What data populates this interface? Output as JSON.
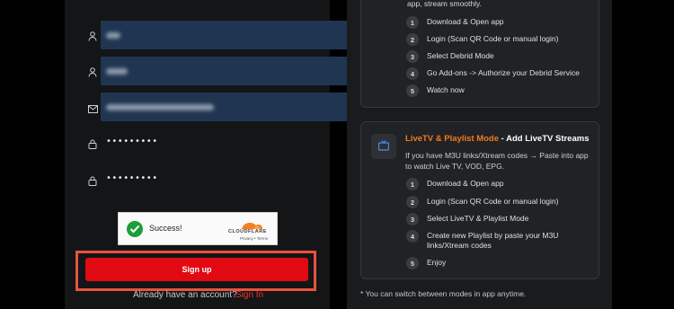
{
  "form": {
    "fields": [
      {
        "type": "text",
        "icon": "user-icon",
        "masked": false
      },
      {
        "type": "text",
        "icon": "user-icon",
        "masked": false
      },
      {
        "type": "email",
        "icon": "mail-icon",
        "masked": false
      },
      {
        "type": "password",
        "icon": "lock-icon",
        "value": "•••••••••"
      },
      {
        "type": "password",
        "icon": "lock-icon",
        "value": "•••••••••"
      }
    ],
    "captcha": {
      "status": "Success!",
      "provider": "CLOUDFLARE",
      "links": "Privacy • Terms"
    },
    "signup_label": "Sign up",
    "already_text": "Already have an account?",
    "signin_label": "Sign In"
  },
  "right": {
    "card1": {
      "cut_text": "app, stream smoothly.",
      "steps": [
        {
          "num": "1",
          "text": "Download & Open app"
        },
        {
          "num": "2",
          "text": "Login (Scan QR Code or manual login)"
        },
        {
          "num": "3",
          "text": "Select Debrid Mode"
        },
        {
          "num": "4",
          "text": "Go Add-ons -> Authorize your Debrid Service"
        },
        {
          "num": "5",
          "text": "Watch now"
        }
      ]
    },
    "card2": {
      "title_highlight": "LiveTV & Playlist Mode",
      "title_rest": " - Add LiveTV Streams",
      "description": "If you have M3U links/Xtream codes → Paste into app to watch Live TV, VOD, EPG.",
      "steps": [
        {
          "num": "1",
          "text": "Download & Open app"
        },
        {
          "num": "2",
          "text": "Login (Scan QR Code or manual login)"
        },
        {
          "num": "3",
          "text": "Select LiveTV & Playlist Mode"
        },
        {
          "num": "4",
          "text": "Create new Playlist by paste your M3U links/Xtream codes"
        },
        {
          "num": "5",
          "text": "Enjoy"
        }
      ]
    },
    "footnote": "* You can switch between modes in app anytime."
  },
  "colors": {
    "accent_red": "#e10a12",
    "highlight_orange": "#f07c1c",
    "input_fill": "#1f3552"
  }
}
